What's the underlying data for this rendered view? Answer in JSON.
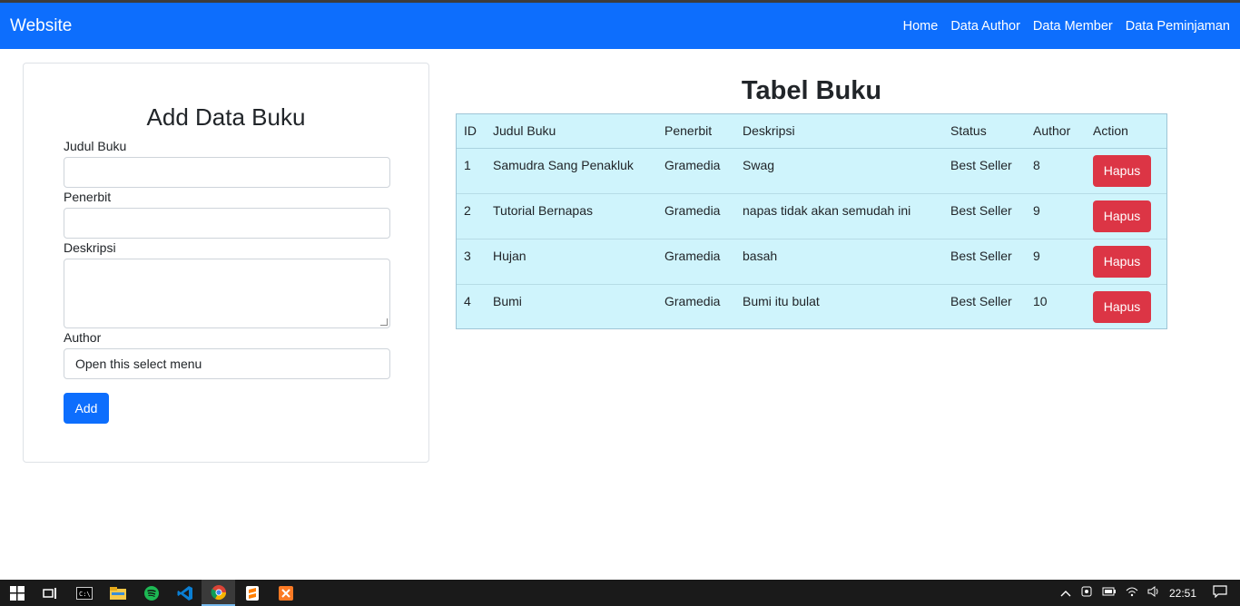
{
  "navbar": {
    "brand": "Website",
    "links": [
      "Home",
      "Data Author",
      "Data Member",
      "Data Peminjaman"
    ]
  },
  "form": {
    "title": "Add Data Buku",
    "judul_label": "Judul Buku",
    "penerbit_label": "Penerbit",
    "deskripsi_label": "Deskripsi",
    "author_label": "Author",
    "author_select_value": "Open this select menu",
    "add_button": "Add"
  },
  "table": {
    "title": "Tabel Buku",
    "headers": [
      "ID",
      "Judul Buku",
      "Penerbit",
      "Deskripsi",
      "Status",
      "Author",
      "Action"
    ],
    "rows": [
      {
        "id": "1",
        "judul": "Samudra Sang Penakluk",
        "penerbit": "Gramedia",
        "deskripsi": "Swag",
        "status": "Best Seller",
        "author": "8",
        "action": "Hapus"
      },
      {
        "id": "2",
        "judul": "Tutorial Bernapas",
        "penerbit": "Gramedia",
        "deskripsi": "napas tidak akan semudah ini",
        "status": "Best Seller",
        "author": "9",
        "action": "Hapus"
      },
      {
        "id": "3",
        "judul": "Hujan",
        "penerbit": "Gramedia",
        "deskripsi": "basah",
        "status": "Best Seller",
        "author": "9",
        "action": "Hapus"
      },
      {
        "id": "4",
        "judul": "Bumi",
        "penerbit": "Gramedia",
        "deskripsi": "Bumi itu bulat",
        "status": "Best Seller",
        "author": "10",
        "action": "Hapus"
      }
    ]
  },
  "taskbar": {
    "icons": [
      "windows-start-icon",
      "task-view-icon",
      "terminal-icon",
      "file-explorer-icon",
      "spotify-icon",
      "vscode-icon",
      "chrome-icon",
      "sublime-icon",
      "xampp-icon"
    ],
    "clock": "22:51"
  },
  "colors": {
    "primary": "#0d6efd",
    "danger": "#dc3545",
    "table_bg": "#cff4fc"
  }
}
